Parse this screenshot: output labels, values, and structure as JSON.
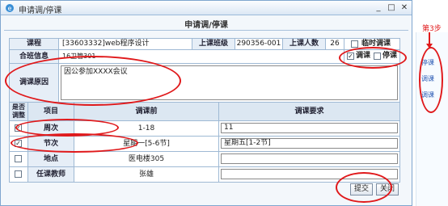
{
  "window": {
    "title": "申请调/停课"
  },
  "form": {
    "heading": "申请调/停课",
    "course_label": "课程",
    "course_value": "[33603332]web程序设计",
    "class_label": "上课班级",
    "class_value": "290356-001",
    "students_label": "上课人数",
    "students_value": "26",
    "temp_label": "临时调课",
    "merged_label": "合班信息",
    "merged_value": "16卫管301",
    "adjust_label": "调课",
    "stop_label": "停课",
    "reason_label": "调课原因",
    "reason_value": "因公参加XXXX会议"
  },
  "grid": {
    "headers": [
      "是否调整",
      "项目",
      "调课前",
      "调课要求"
    ],
    "rows": [
      {
        "item": "周次",
        "before": "1-18",
        "request": "11",
        "checked": true
      },
      {
        "item": "节次",
        "before": "星期一[5-6节]",
        "request": "星期五[1-2节]",
        "checked": true
      },
      {
        "item": "地点",
        "before": "医电楼305",
        "request": "",
        "checked": false
      },
      {
        "item": "任课教师",
        "before": "张雄",
        "request": "",
        "checked": false
      }
    ]
  },
  "buttons": {
    "submit": "提交",
    "close": "关闭"
  },
  "side": {
    "step": "第3步",
    "items": [
      "停课",
      "调课",
      "调课"
    ]
  },
  "colors": {
    "annotation": "#e0191b",
    "header": "#dce7f2",
    "border": "#9fb9d4"
  },
  "icons": {
    "app": "ie-icon",
    "minimize": "minimize-icon",
    "maximize": "maximize-icon",
    "close": "close-icon"
  }
}
